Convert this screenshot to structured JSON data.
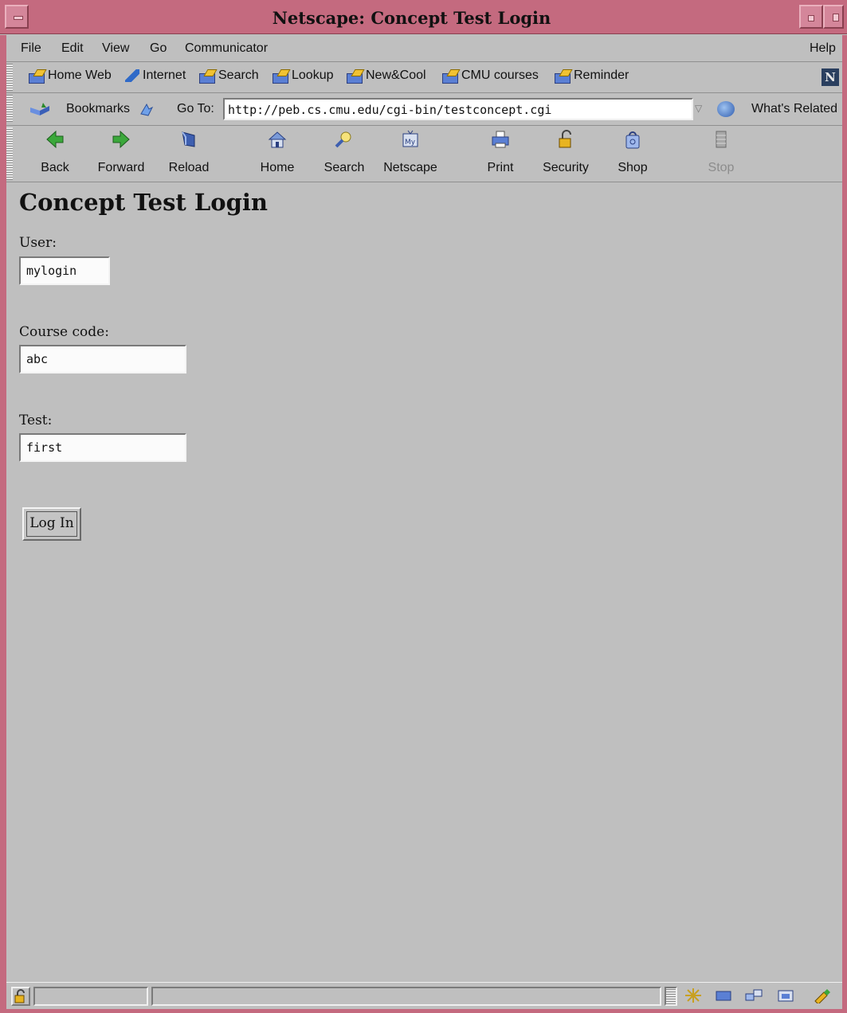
{
  "window": {
    "title": "Netscape: Concept Test Login"
  },
  "menubar": {
    "items": [
      "File",
      "Edit",
      "View",
      "Go",
      "Communicator"
    ],
    "help": "Help"
  },
  "personal_toolbar": {
    "items": [
      "Home Web",
      "Internet",
      "Search",
      "Lookup",
      "New&Cool",
      "CMU courses",
      "Reminder"
    ]
  },
  "location_bar": {
    "bookmarks_label": "Bookmarks",
    "goto_label": "Go To:",
    "url": "http://peb.cs.cmu.edu/cgi-bin/testconcept.cgi",
    "whats_related": "What's Related"
  },
  "nav_toolbar": {
    "buttons": [
      {
        "label": "Back",
        "icon": "back-arrow-icon",
        "enabled": true
      },
      {
        "label": "Forward",
        "icon": "forward-arrow-icon",
        "enabled": true
      },
      {
        "label": "Reload",
        "icon": "reload-icon",
        "enabled": true
      },
      {
        "label": "Home",
        "icon": "home-icon",
        "enabled": true
      },
      {
        "label": "Search",
        "icon": "search-icon",
        "enabled": true
      },
      {
        "label": "Netscape",
        "icon": "my-netscape-icon",
        "enabled": true
      },
      {
        "label": "Print",
        "icon": "printer-icon",
        "enabled": true
      },
      {
        "label": "Security",
        "icon": "padlock-icon",
        "enabled": true
      },
      {
        "label": "Shop",
        "icon": "shopping-bag-icon",
        "enabled": true
      },
      {
        "label": "Stop",
        "icon": "stop-icon",
        "enabled": false
      }
    ]
  },
  "page": {
    "heading": "Concept Test Login",
    "user_label": "User:",
    "user_value": "mylogin",
    "course_label": "Course code:",
    "course_value": "abc",
    "test_label": "Test:",
    "test_value": "first",
    "login_button": "Log In"
  },
  "colors": {
    "titlebar": "#c46a7f",
    "chrome": "#bfbfbf"
  }
}
